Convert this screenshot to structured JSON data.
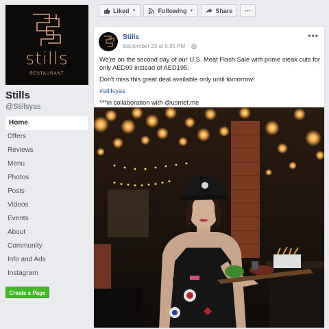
{
  "page": {
    "logo_word": "stills",
    "logo_sub": "RESTAURANT",
    "name": "Stills",
    "handle": "@Stillsyas"
  },
  "nav": {
    "items": [
      "Home",
      "Offers",
      "Reviews",
      "Menu",
      "Photos",
      "Posts",
      "Videos",
      "Events",
      "About",
      "Community",
      "Info and Ads",
      "Instagram"
    ],
    "active": "Home"
  },
  "create_page_label": "Create a Page",
  "topbar": {
    "liked_label": "Liked",
    "following_label": "Following",
    "share_label": "Share",
    "more_label": "···"
  },
  "post": {
    "author": "Stills",
    "timestamp": "September 23 at 5:35 PM",
    "more_label": "•••",
    "line1": "We're on the second day of our U.S. Meat Flash Sale with prime steak cuts for only AED99 instead of AED195.",
    "line2": "Don't miss this great deal available only until tomorrow!",
    "hashtag": "#stillsyas",
    "line3": "***in collaboration with @usmef.me"
  },
  "colors": {
    "brand_blue": "#385898",
    "logo_copper": "#d8a17f",
    "create_green": "#42b72a"
  },
  "icons": [
    "thumbs-up-icon",
    "rss-icon",
    "share-arrow-icon",
    "globe-icon"
  ]
}
